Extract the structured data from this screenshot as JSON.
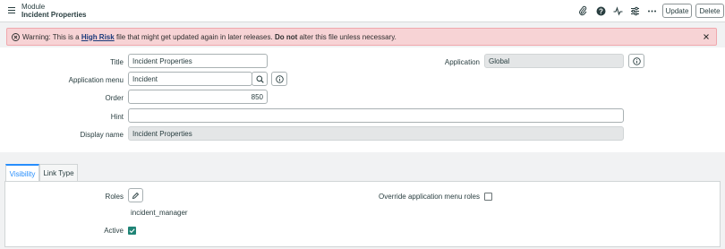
{
  "header": {
    "breadcrumb": "Module",
    "title": "Incident Properties",
    "icons": [
      "paperclip-icon",
      "help-icon",
      "activity-icon",
      "settings-sliders-icon",
      "more-icon"
    ],
    "update_label": "Update",
    "delete_label": "Delete"
  },
  "warning": {
    "prefix": "Warning: This is a ",
    "link": "High Risk",
    "middle": " file that might get updated again in later releases. ",
    "bold": "Do not",
    "suffix": " alter this file unless necessary."
  },
  "form": {
    "title_label": "Title",
    "title_value": "Incident Properties",
    "application_label": "Application",
    "application_value": "Global",
    "app_menu_label": "Application menu",
    "app_menu_value": "Incident",
    "order_label": "Order",
    "order_value": "850",
    "hint_label": "Hint",
    "hint_value": "",
    "display_name_label": "Display name",
    "display_name_value": "Incident Properties"
  },
  "tabs": {
    "visibility": "Visibility",
    "link_type": "Link Type"
  },
  "visibility": {
    "roles_label": "Roles",
    "roles_value": "incident_manager",
    "override_label": "Override application menu roles",
    "override_checked": false,
    "active_label": "Active",
    "active_checked": true
  },
  "colors": {
    "accent": "#278efc",
    "warning_bg": "#f7d3d5",
    "checkbox_checked": "#1f8476"
  }
}
